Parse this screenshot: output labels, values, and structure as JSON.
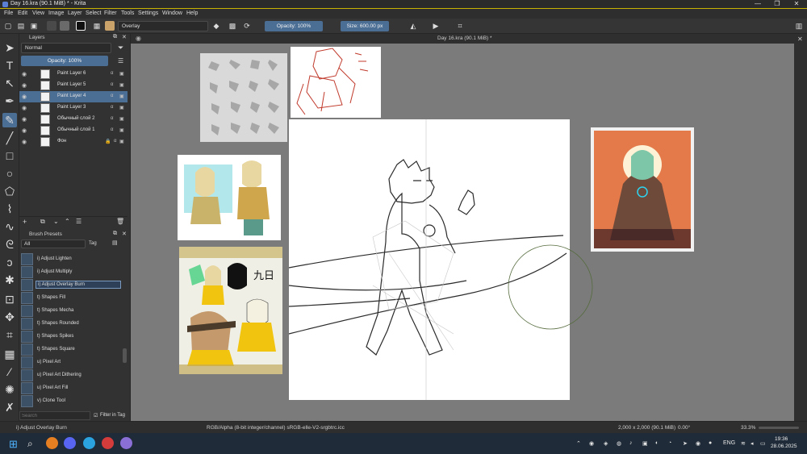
{
  "window": {
    "title": "Day 16.kra (90.1 MiB) * - Krita",
    "controls": [
      "—",
      "❐",
      "✕"
    ]
  },
  "menu": [
    "File",
    "Edit",
    "View",
    "Image",
    "Layer",
    "Select",
    "Filter",
    "Tools",
    "Settings",
    "Window",
    "Help"
  ],
  "toolbar": {
    "blend_mode": "Overlay",
    "opacity": "Opacity: 100%",
    "size": "Size: 600.00 px"
  },
  "layers_panel": {
    "title": "Layers",
    "blend_mode": "Normal",
    "opacity": "Opacity: 100%",
    "layers": [
      {
        "name": "Paint Layer 6",
        "selected": false
      },
      {
        "name": "Paint Layer 5",
        "selected": false
      },
      {
        "name": "Paint Layer 4",
        "selected": true
      },
      {
        "name": "Paint Layer 3",
        "selected": false
      },
      {
        "name": "Обычный слой 2",
        "selected": false
      },
      {
        "name": "Обычный слой 1",
        "selected": false
      },
      {
        "name": "Фон",
        "selected": false
      }
    ]
  },
  "brush_presets": {
    "title": "Brush Presets",
    "filter": "All",
    "tag_label": "Tag",
    "search_placeholder": "Search",
    "filter_in_tag": "Filter in Tag",
    "items": [
      {
        "name": "i) Adjust Lighten",
        "selected": false
      },
      {
        "name": "i) Adjust Multiply",
        "selected": false
      },
      {
        "name": "i) Adjust Overlay Burn",
        "selected": true
      },
      {
        "name": "t) Shapes Fill",
        "selected": false
      },
      {
        "name": "t) Shapes Mecha",
        "selected": false
      },
      {
        "name": "t) Shapes Rounded",
        "selected": false
      },
      {
        "name": "t) Shapes Spikes",
        "selected": false
      },
      {
        "name": "t) Shapes Square",
        "selected": false
      },
      {
        "name": "u) Pixel Art",
        "selected": false
      },
      {
        "name": "u) Pixel Art Dithering",
        "selected": false
      },
      {
        "name": "u) Pixel Art Fill",
        "selected": false
      },
      {
        "name": "v) Clone Tool",
        "selected": false
      }
    ]
  },
  "canvas": {
    "doc_tab": "Day 16.kra (90.1 MiB) *",
    "ref_text": "九日"
  },
  "status": {
    "brush": "i) Adjust Overlay Burn",
    "color_info": "RGB/Alpha (8-bit integer/channel)  sRGB-elle-V2-srgbtrc.icc",
    "dims": "2,000 x 2,000 (90.1 MiB)",
    "rotation": "0.00°",
    "zoom": "33.3%"
  },
  "taskbar": {
    "lang": "ENG",
    "time": "19:36",
    "date": "28.06.2025"
  }
}
